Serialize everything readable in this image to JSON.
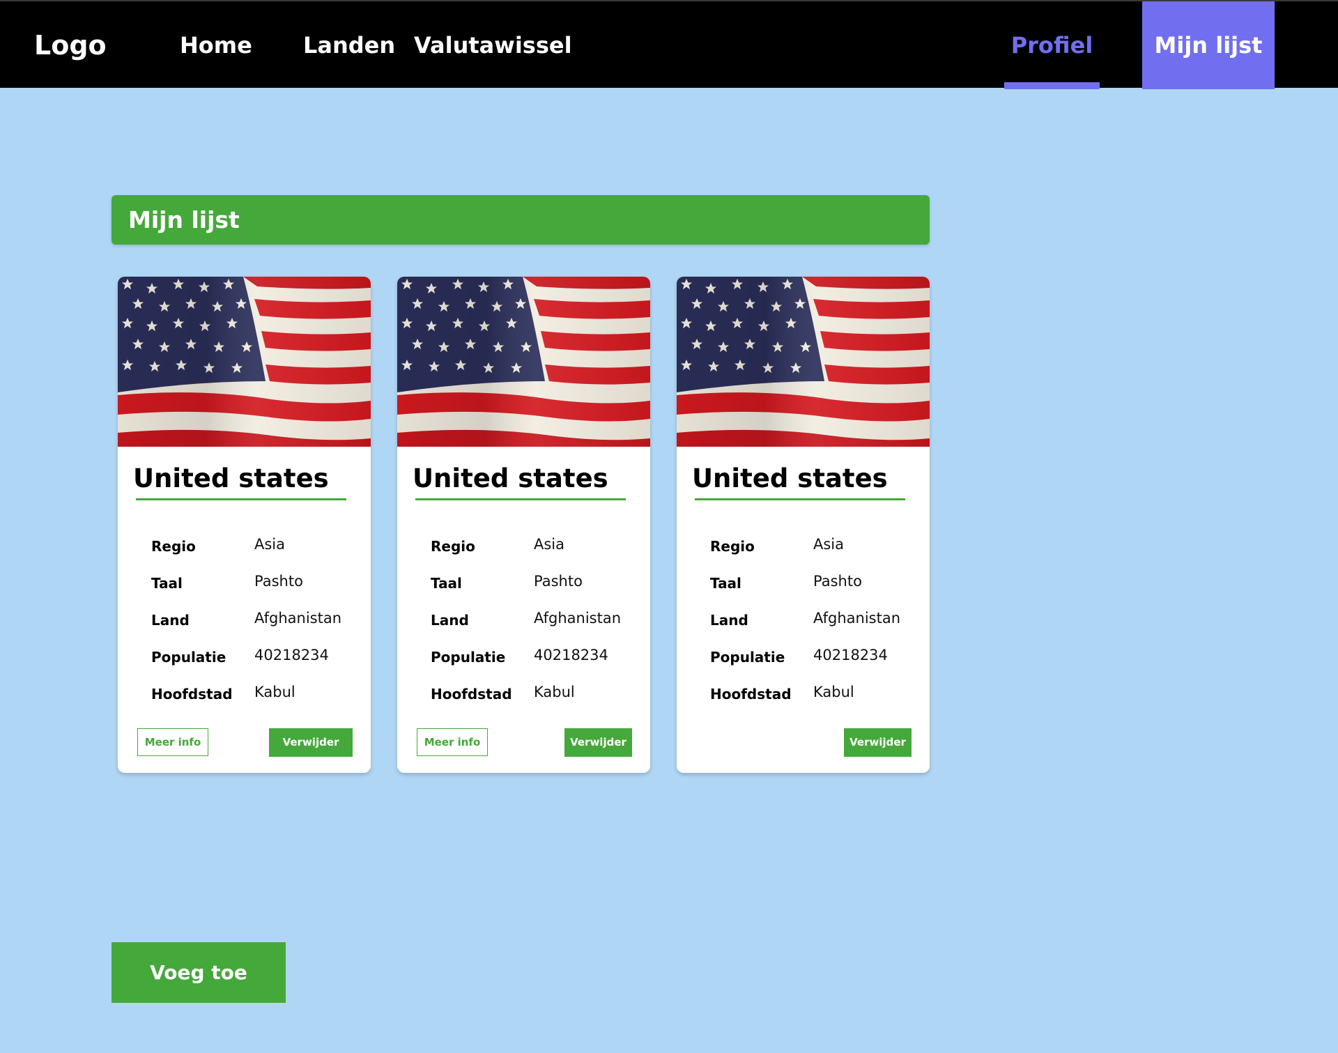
{
  "nav": {
    "logo": "Logo",
    "home": "Home",
    "landen": "Landen",
    "valutawissel": "Valutawissel",
    "profiel": "Profiel",
    "mijn_lijst": "Mijn lijst",
    "active_color": "#716ff0"
  },
  "section": {
    "title": "Mijn lijst"
  },
  "colors": {
    "accent_green": "#45a83a",
    "background": "#b0d6f5",
    "accent_purple": "#716ff0"
  },
  "cards": [
    {
      "country": "United states",
      "flag_icon": "us-flag-image",
      "labels": {
        "regio": "Regio",
        "taal": "Taal",
        "land": "Land",
        "populatie": "Populatie",
        "hoofdstad": "Hoofdstad"
      },
      "values": {
        "regio": "Asia",
        "taal": "Pashto",
        "land": "Afghanistan",
        "populatie": "40218234",
        "hoofdstad": "Kabul"
      },
      "meer_info": "Meer info",
      "verwijder": "Verwijder"
    },
    {
      "country": "United states",
      "flag_icon": "us-flag-image",
      "labels": {
        "regio": "Regio",
        "taal": "Taal",
        "land": "Land",
        "populatie": "Populatie",
        "hoofdstad": "Hoofdstad"
      },
      "values": {
        "regio": "Asia",
        "taal": "Pashto",
        "land": "Afghanistan",
        "populatie": "40218234",
        "hoofdstad": "Kabul"
      },
      "meer_info": "Meer info",
      "verwijder": "Verwijder"
    },
    {
      "country": "United states",
      "flag_icon": "us-flag-image",
      "labels": {
        "regio": "Regio",
        "taal": "Taal",
        "land": "Land",
        "populatie": "Populatie",
        "hoofdstad": "Hoofdstad"
      },
      "values": {
        "regio": "Asia",
        "taal": "Pashto",
        "land": "Afghanistan",
        "populatie": "40218234",
        "hoofdstad": "Kabul"
      },
      "verwijder": "Verwijder"
    }
  ],
  "actions": {
    "voeg_toe": "Voeg toe"
  }
}
